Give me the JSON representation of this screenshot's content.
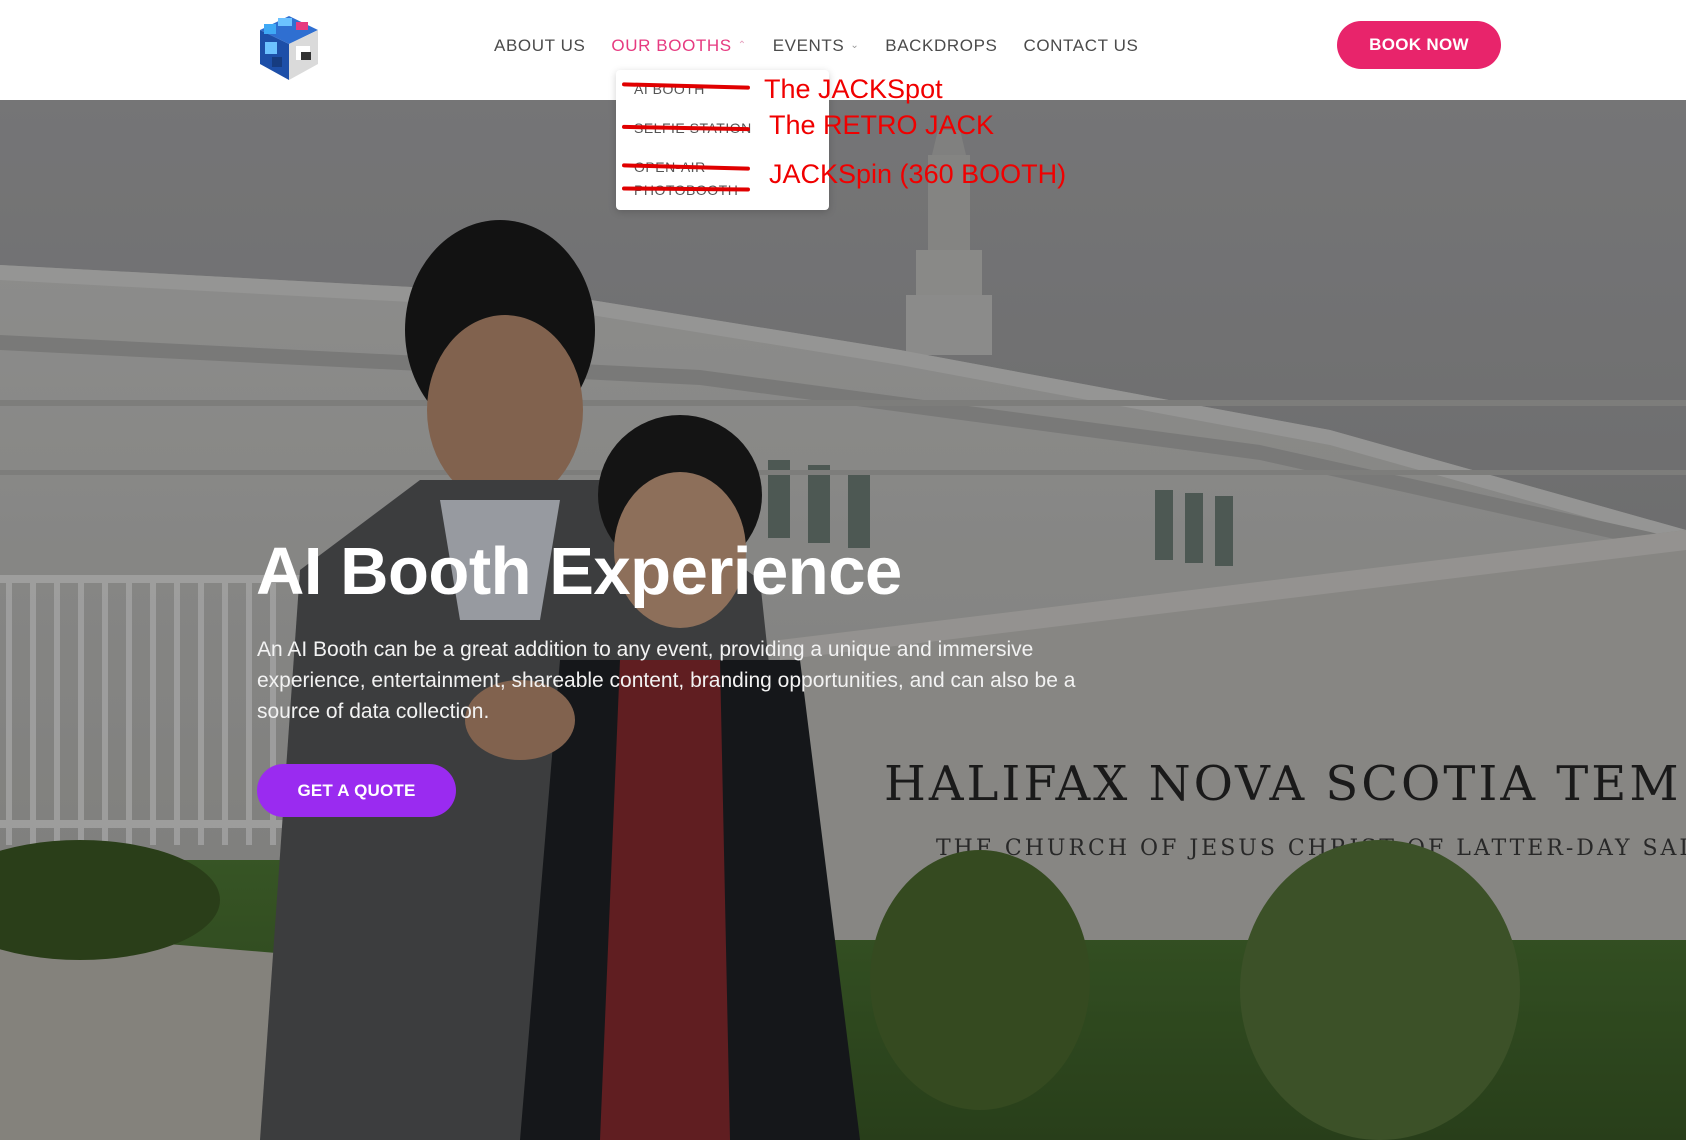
{
  "logo": {
    "icon": "cube-logo-icon"
  },
  "nav": {
    "items": [
      {
        "label": "ABOUT US",
        "has_caret": false
      },
      {
        "label": "OUR BOOTHS",
        "has_caret": true,
        "active": true
      },
      {
        "label": "EVENTS",
        "has_caret": true
      },
      {
        "label": "BACKDROPS",
        "has_caret": false
      },
      {
        "label": "CONTACT US",
        "has_caret": false
      }
    ]
  },
  "header": {
    "book_now_label": "BOOK NOW"
  },
  "dropdown": {
    "items": [
      {
        "label": "AI BOOTH"
      },
      {
        "label": "SELFIE STATION"
      },
      {
        "label": "OPEN-AIR PHOTOBOOTH"
      }
    ]
  },
  "annotations": [
    {
      "text": "The JACKSpot"
    },
    {
      "text": "The RETRO JACK"
    },
    {
      "text": "JACKSpin (360 BOOTH)"
    }
  ],
  "hero": {
    "title": "AI Booth Experience",
    "description": "An AI Booth can be a great addition to any event, providing a unique and immersive experience, entertainment, shareable content, branding opportunities, and can also be a source of data collection.",
    "cta_label": "GET A QUOTE",
    "sign_line1": "HALIFAX NOVA SCOTIA TEM",
    "sign_line2": "THE CHURCH OF JESUS CHRIST OF LATTER-DAY SAIN"
  },
  "colors": {
    "accent_pink": "#e8246b",
    "active_nav": "#e63a80",
    "cta_purple": "#9a2bf0",
    "annotation_red": "#f00000"
  }
}
